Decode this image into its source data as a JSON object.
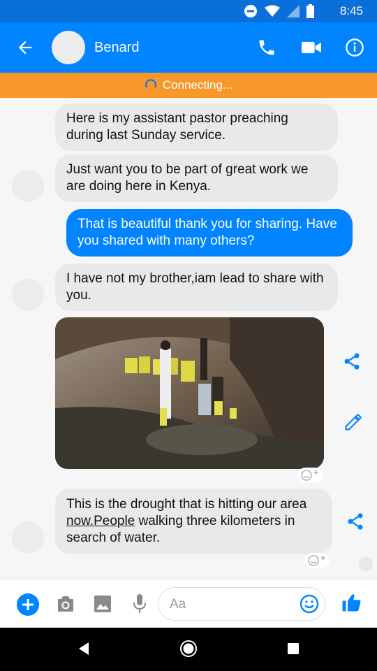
{
  "status": {
    "time": "8:45"
  },
  "header": {
    "contact_name": "Benard"
  },
  "banner": {
    "text": "Connecting..."
  },
  "messages": [
    {
      "from": "them",
      "text": "Here is my assistant pastor preaching during last Sunday service."
    },
    {
      "from": "them",
      "text": "Just want you to be part of great work we are doing here in Kenya."
    },
    {
      "from": "me",
      "text": "That is beautiful thank you for sharing. Have you shared with many others?"
    },
    {
      "from": "them",
      "text": "I have not my brother,iam lead to share with you."
    },
    {
      "from": "them",
      "text_before": "This is the drought that is hitting our area ",
      "link": "now.People",
      "text_after": " walking three kilometers in search of water."
    }
  ],
  "composer": {
    "placeholder": "Aa"
  },
  "colors": {
    "brand": "#0084ff",
    "banner": "#f8982a",
    "bubble_incoming": "#e9e9e9"
  },
  "icons": [
    "back-arrow-icon",
    "phone-icon",
    "video-camera-icon",
    "info-icon",
    "share-icon",
    "edit-pencil-icon",
    "add-reaction-icon",
    "plus-icon",
    "camera-icon",
    "image-icon",
    "microphone-icon",
    "emoji-icon",
    "thumbs-up-icon"
  ]
}
